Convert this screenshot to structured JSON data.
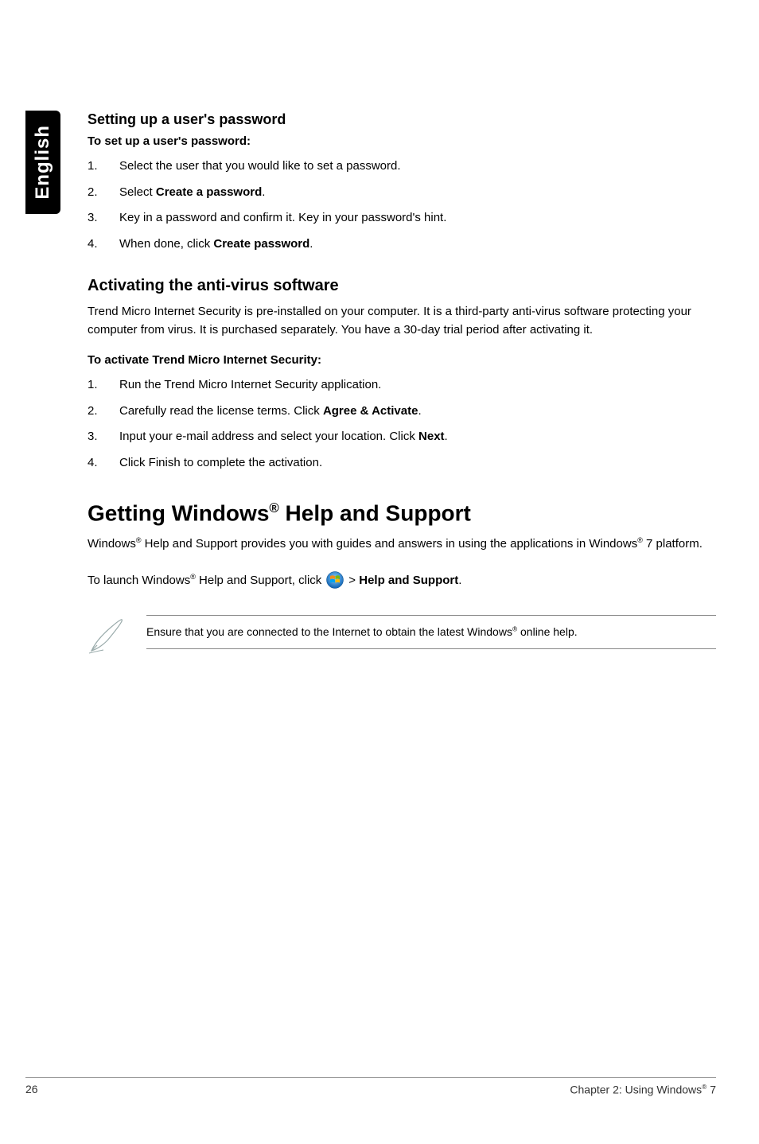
{
  "sidebar": {
    "language": "English"
  },
  "section1": {
    "heading": "Setting up a user's password",
    "subheading": "To set up a user's password:",
    "steps": {
      "s1": "Select the user that you would like to set a password.",
      "s2_pre": "Select ",
      "s2_bold": "Create a password",
      "s2_post": ".",
      "s3": "Key in a password and confirm it. Key in your password's hint.",
      "s4_pre": "When done, click ",
      "s4_bold": "Create password",
      "s4_post": "."
    }
  },
  "section2": {
    "heading": "Activating the anti-virus software",
    "intro": "Trend Micro Internet Security is pre-installed on your computer. It is a third-party anti-virus software protecting your computer from virus. It is purchased separately. You have a 30-day trial period after activating it.",
    "subheading": "To activate Trend Micro Internet Security:",
    "steps": {
      "s1": "Run the Trend Micro Internet Security application.",
      "s2_pre": "Carefully read the license terms. Click ",
      "s2_bold": "Agree & Activate",
      "s2_post": ".",
      "s3_pre": "Input your e-mail address and select your location. Click ",
      "s3_bold": "Next",
      "s3_post": ".",
      "s4": "Click Finish to complete the activation."
    }
  },
  "section3": {
    "heading_pre": "Getting Windows",
    "heading_sup": "®",
    "heading_post": " Help and Support",
    "body_pre1": "Windows",
    "body_sup1": "®",
    "body_mid1": " Help and Support provides you with guides and answers in using the applications in Windows",
    "body_sup2": "®",
    "body_post1": " 7 platform.",
    "launch_pre": "To launch Windows",
    "launch_sup": "®",
    "launch_mid": " Help and Support, click ",
    "launch_gt": " > ",
    "launch_bold": "Help and Support",
    "launch_post": ".",
    "note_pre": "Ensure that you are connected to the Internet to obtain the latest Windows",
    "note_sup": "®",
    "note_post": " online help."
  },
  "footer": {
    "page": "26",
    "chapter_pre": "Chapter 2: Using Windows",
    "chapter_sup": "®",
    "chapter_post": " 7"
  }
}
